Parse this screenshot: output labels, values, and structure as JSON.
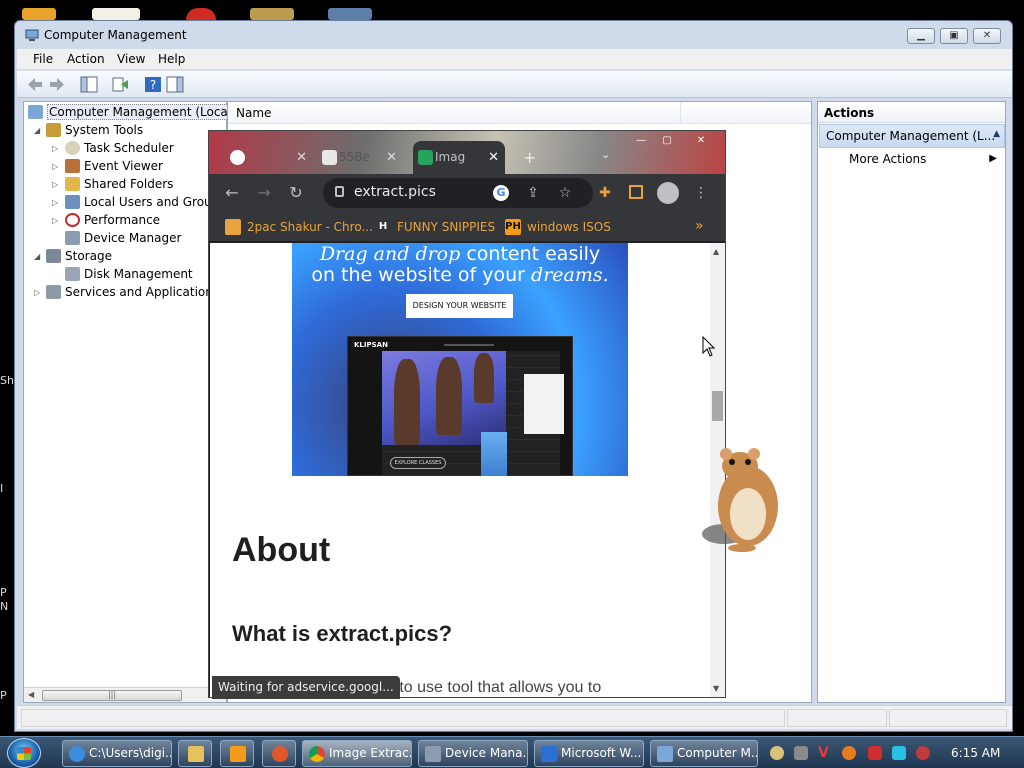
{
  "desktop": {
    "edge_labels": [
      "Sh",
      "I",
      "P",
      "N",
      "P"
    ]
  },
  "computer_management": {
    "title": "Computer Management",
    "menu": [
      "File",
      "Action",
      "View",
      "Help"
    ],
    "tree": {
      "root": "Computer Management (Local",
      "system_tools": "System Tools",
      "task_scheduler": "Task Scheduler",
      "event_viewer": "Event Viewer",
      "shared_folders": "Shared Folders",
      "local_users": "Local Users and Groups",
      "performance": "Performance",
      "device_manager": "Device Manager",
      "storage": "Storage",
      "disk_management": "Disk Management",
      "services": "Services and Applications"
    },
    "column_name": "Name",
    "actions": {
      "header": "Actions",
      "section": "Computer Management (L...",
      "more": "More Actions"
    }
  },
  "chrome": {
    "tabs": [
      {
        "label": "",
        "active": false
      },
      {
        "label": "55Be",
        "active": false
      },
      {
        "label": "Imag",
        "active": true
      }
    ],
    "url": "extract.pics",
    "bookmarks": [
      {
        "label": "2pac Shakur - Chro...",
        "icon_text": "",
        "icon": "briefcase-icon"
      },
      {
        "label": "FUNNY SNIPPIES",
        "icon_text": "H",
        "icon": "h-logo-icon"
      },
      {
        "label": "windows ISOS",
        "icon_text": "PH",
        "icon": "ph-logo-icon"
      }
    ],
    "more_bookmarks": "»",
    "page": {
      "hero_line1_italic": "Drag and drop",
      "hero_line1_rest": " content easily",
      "hero_line2_rest": "on the website of your ",
      "hero_line2_italic": "dreams.",
      "hero_cta": "DESIGN YOUR WEBSITE",
      "mock_brand": "KLIPSAN",
      "mock_button": "EXPLORE CLASSES",
      "about_heading": "About",
      "what_heading": "What is extract.pics?",
      "paragraph": "asy to use tool that allows you to"
    },
    "status_text": "Waiting for adservice.googl..."
  },
  "taskbar": {
    "items": [
      {
        "label": "C:\\Users\\digi...",
        "active": false
      },
      {
        "label": "",
        "active": false
      },
      {
        "label": "",
        "active": false
      },
      {
        "label": "",
        "active": false
      },
      {
        "label": "Image Extrac...",
        "active": true
      },
      {
        "label": "Device Mana...",
        "active": false
      },
      {
        "label": "Microsoft W...",
        "active": false
      },
      {
        "label": "Computer M...",
        "active": false
      }
    ],
    "clock": "6:15 AM"
  }
}
